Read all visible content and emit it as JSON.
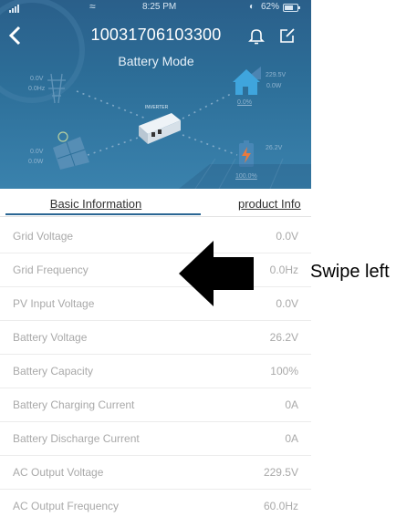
{
  "status_bar": {
    "time": "8:25 PM",
    "battery": "62%"
  },
  "header": {
    "device_id": "10031706103300",
    "mode": "Battery Mode"
  },
  "hero": {
    "grid": [
      "0.0V",
      "0.0Hz"
    ],
    "pv": [
      "0.0V",
      "0.0W"
    ],
    "inverter_label": "INVERTER",
    "load": [
      "229.5V",
      "0.0W"
    ],
    "load_percent": "0.0%",
    "battery_voltage": "26.2V",
    "battery_percent": "100.0%"
  },
  "tabs": {
    "basic": "Basic Information",
    "product": "product Info"
  },
  "rows": [
    {
      "label": "Grid Voltage",
      "value": "0.0V"
    },
    {
      "label": "Grid Frequency",
      "value": "0.0Hz"
    },
    {
      "label": "PV Input Voltage",
      "value": "0.0V"
    },
    {
      "label": "Battery Voltage",
      "value": "26.2V"
    },
    {
      "label": "Battery Capacity",
      "value": "100%"
    },
    {
      "label": "Battery Charging Current",
      "value": "0A"
    },
    {
      "label": "Battery Discharge Current",
      "value": "0A"
    },
    {
      "label": "AC Output Voltage",
      "value": "229.5V"
    },
    {
      "label": "AC Output Frequency",
      "value": "60.0Hz"
    }
  ],
  "annotation": {
    "swipe_label": "Swipe left"
  },
  "colors": {
    "header_blue": "#2d6f99",
    "tab_underline": "#2b6693",
    "row_text": "#a9a9a9"
  },
  "icons": [
    "back-icon",
    "bell-icon",
    "edit-icon",
    "signal-icon",
    "wifi-icon",
    "battery-status-icon",
    "inverter-icon",
    "home-icon",
    "battery-icon",
    "solar-panel-icon",
    "grid-tower-icon",
    "swipe-left-arrow-icon"
  ]
}
